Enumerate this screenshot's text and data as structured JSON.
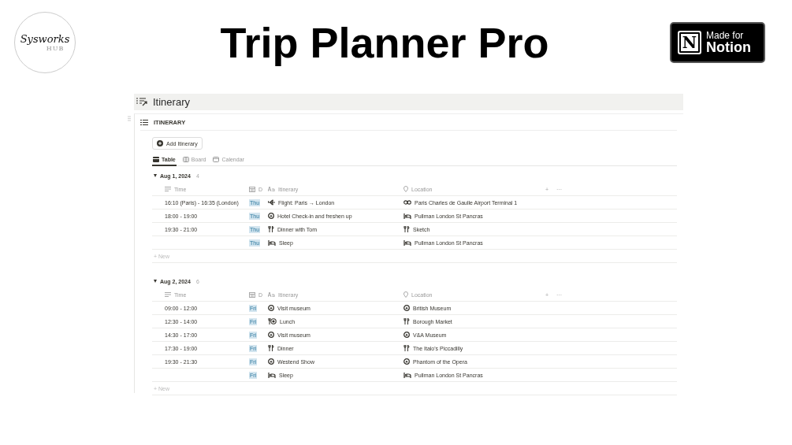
{
  "brand": {
    "logo_main": "Sysworks",
    "logo_sub": "HUB",
    "title": "Trip Planner Pro",
    "badge_mark": "N",
    "badge_top": "Made for",
    "badge_bottom": "Notion"
  },
  "page": {
    "title": "Itinerary",
    "database_title": "ITINERARY",
    "add_button": "Add Itinerary",
    "tabs": [
      {
        "label": "Table",
        "kind": "table",
        "selected": true
      },
      {
        "label": "Board",
        "kind": "board",
        "selected": false
      },
      {
        "label": "Calendar",
        "kind": "calendar",
        "selected": false
      }
    ],
    "groups": [
      {
        "label": "Aug 1, 2024",
        "count": "4",
        "expanded": true,
        "new_label": "+ New",
        "columns": [
          {
            "label": "Time",
            "kind": "text"
          },
          {
            "label": "D",
            "kind": "date"
          },
          {
            "label": "Itinerary",
            "kind": "title"
          },
          {
            "label": "Location",
            "kind": "place"
          }
        ],
        "column_actions": [
          "+",
          "···"
        ],
        "rows": [
          {
            "time": "16:10 (Paris) - 16:35 (London)",
            "day": "Thu",
            "item": "Flight: Paris → London",
            "item_icon": {
              "kind": "plane"
            },
            "location": "Paris Charles de Gaulle Airport Terminal 1",
            "location_icon": {
              "kind": "link"
            }
          },
          {
            "time": "18:00 - 19:00",
            "day": "Thu",
            "item": "Hotel Check-in and freshen up",
            "item_icon": {
              "kind": "place"
            },
            "location": "Pullman London St Pancras",
            "location_icon": {
              "kind": "bed"
            }
          },
          {
            "time": "19:30 - 21:00",
            "day": "Thu",
            "item": "Dinner with Tom",
            "item_icon": {
              "kind": "cutlery"
            },
            "location": "Sketch",
            "location_icon": {
              "kind": "cutlery"
            }
          },
          {
            "day": "Thu",
            "item": "Sleep",
            "item_icon": {
              "kind": "bed"
            },
            "location": "Pullman London St Pancras",
            "location_icon": {
              "kind": "bed"
            }
          }
        ]
      },
      {
        "label": "Aug 2, 2024",
        "count": "6",
        "expanded": true,
        "new_label": "+ New",
        "columns": [
          {
            "label": "Time",
            "kind": "text"
          },
          {
            "label": "D",
            "kind": "date"
          },
          {
            "label": "Itinerary",
            "kind": "title"
          },
          {
            "label": "Location",
            "kind": "place"
          }
        ],
        "column_actions": [
          "+",
          "···"
        ],
        "rows": [
          {
            "time": "09:00 - 12:00",
            "day": "Fri",
            "item": "Visit museum",
            "item_icon": {
              "kind": "place"
            },
            "location": "British Museum",
            "location_icon": {
              "kind": "place"
            }
          },
          {
            "time": "12:30 - 14:00",
            "day": "Fri",
            "item": "Lunch",
            "item_icon": {
              "kind": "plate"
            },
            "location": "Borough Market",
            "location_icon": {
              "kind": "cutlery"
            }
          },
          {
            "time": "14:30 - 17:00",
            "day": "Fri",
            "item": "Visit museum",
            "item_icon": {
              "kind": "place"
            },
            "location": "V&A Museum",
            "location_icon": {
              "kind": "place"
            }
          },
          {
            "time": "17:30 - 19:00",
            "day": "Fri",
            "item": "Dinner",
            "item_icon": {
              "kind": "cutlery"
            },
            "location": "The Italo's Piccadilly",
            "location_icon": {
              "kind": "cutlery"
            }
          },
          {
            "time": "19:30 - 21:30",
            "day": "Fri",
            "item": "Westend Show",
            "item_icon": {
              "kind": "place"
            },
            "location": "Phantom of the Opera",
            "location_icon": {
              "kind": "place"
            }
          },
          {
            "day": "Fri",
            "item": "Sleep",
            "item_icon": {
              "kind": "bed"
            },
            "location": "Pullman London St Pancras",
            "location_icon": {
              "kind": "bed"
            }
          }
        ]
      }
    ]
  }
}
